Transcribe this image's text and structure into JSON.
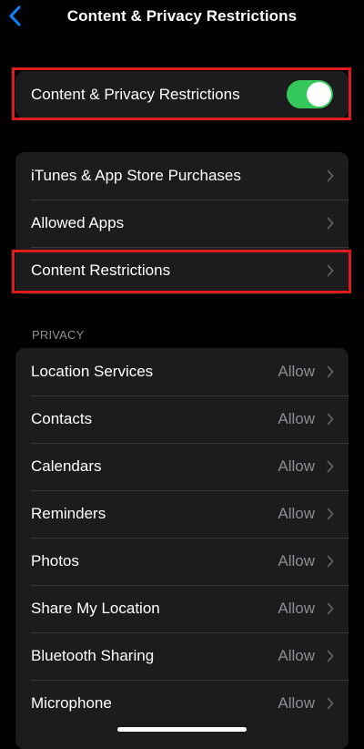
{
  "nav": {
    "title": "Content & Privacy Restrictions"
  },
  "master_toggle": {
    "label": "Content & Privacy Restrictions",
    "state": "on"
  },
  "store_group": {
    "items": [
      {
        "label": "iTunes & App Store Purchases"
      },
      {
        "label": "Allowed Apps"
      },
      {
        "label": "Content Restrictions"
      }
    ]
  },
  "privacy": {
    "header": "PRIVACY",
    "items": [
      {
        "label": "Location Services",
        "value": "Allow"
      },
      {
        "label": "Contacts",
        "value": "Allow"
      },
      {
        "label": "Calendars",
        "value": "Allow"
      },
      {
        "label": "Reminders",
        "value": "Allow"
      },
      {
        "label": "Photos",
        "value": "Allow"
      },
      {
        "label": "Share My Location",
        "value": "Allow"
      },
      {
        "label": "Bluetooth Sharing",
        "value": "Allow"
      },
      {
        "label": "Microphone",
        "value": "Allow"
      }
    ]
  },
  "colors": {
    "accent": "#0a84ff",
    "toggle_on": "#34c759",
    "highlight": "#e01b1b"
  }
}
